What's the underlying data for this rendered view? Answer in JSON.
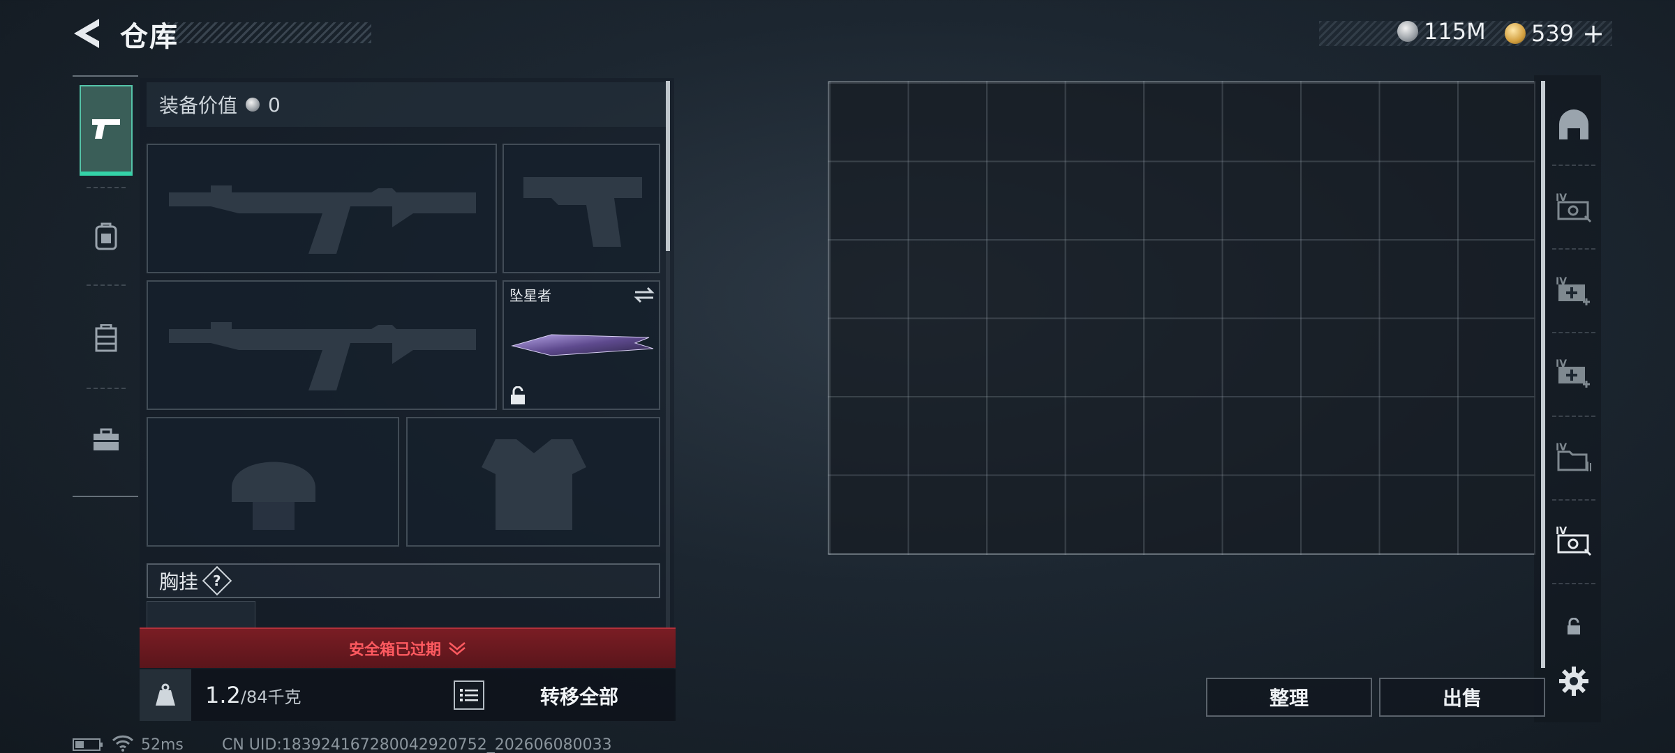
{
  "header": {
    "title": "仓库",
    "currency_silver": "115M",
    "currency_gold": "539",
    "add_symbol": "+"
  },
  "equipment": {
    "value_label": "装备价值",
    "value_amount": "0",
    "melee_name": "坠星者",
    "chest_label": "胸挂",
    "help_symbol": "?",
    "safe_box_status": "安全箱已过期"
  },
  "footer": {
    "weight_current": "1.2",
    "weight_max": "/84千克",
    "transfer_all": "转移全部",
    "sort": "整理",
    "sell": "出售"
  },
  "status_bar": {
    "ping": "52ms",
    "uid": "CN UID:18392416728004292075​2_202606080033"
  },
  "colors": {
    "accent_green": "#34d3a8",
    "alert_red": "#ff5a60",
    "banner_red": "#7a1d24"
  },
  "icons": {
    "nav": [
      "pistol-icon",
      "backpack-icon",
      "vest-icon",
      "toolbox-icon"
    ],
    "right": [
      "helmet-arch-icon",
      "tier-iv-case-icon",
      "tier-iv-medkit-icon",
      "tier-iv-medkit-icon",
      "tier-iv-folder-icon",
      "tier-iv-case-icon",
      "lock-icon",
      "gear-icon"
    ]
  }
}
